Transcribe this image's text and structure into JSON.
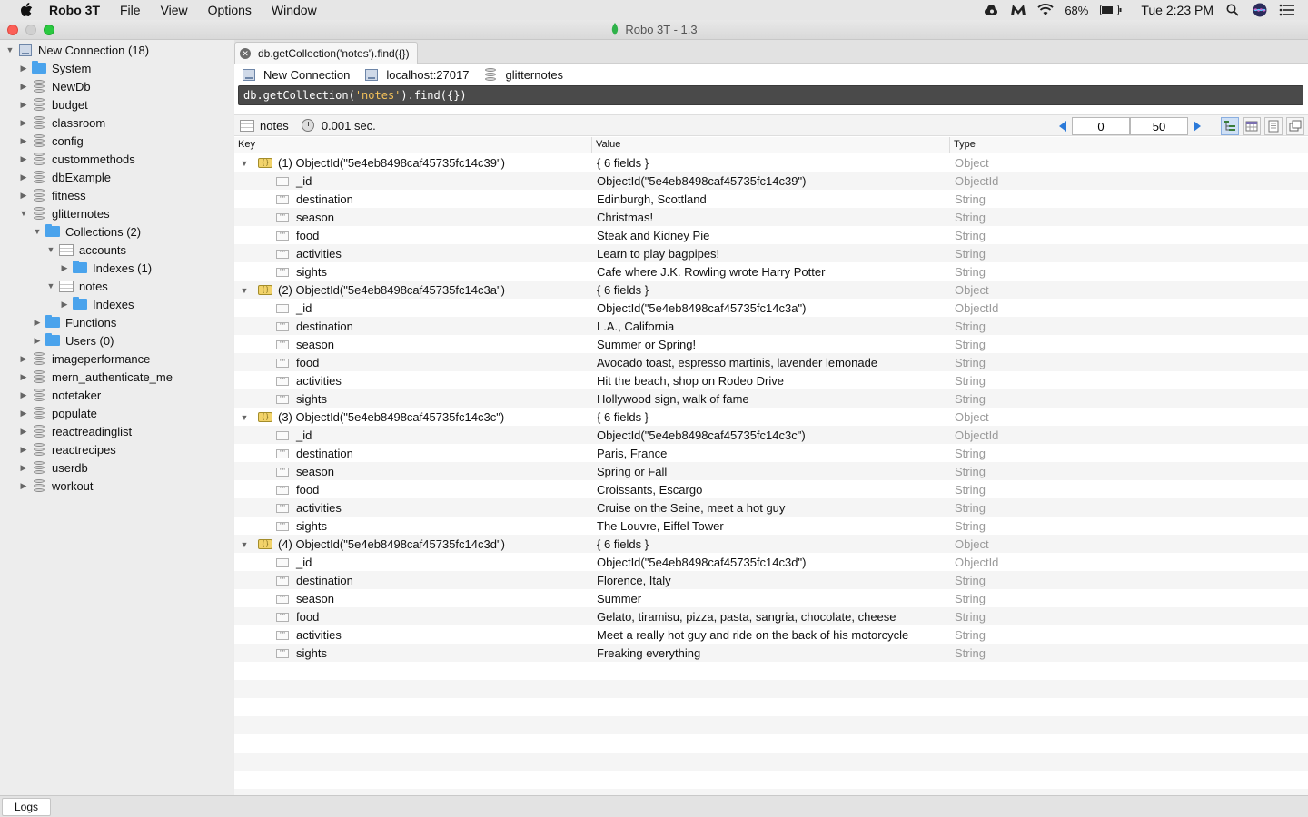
{
  "menubar": {
    "app_name": "Robo 3T",
    "items": [
      "File",
      "View",
      "Options",
      "Window"
    ],
    "battery": "68%",
    "clock": "Tue 2:23 PM"
  },
  "window": {
    "title": "Robo 3T - 1.3"
  },
  "sidebar": {
    "tree": [
      {
        "label": "New Connection (18)",
        "icon": "server-icon",
        "expanded": true,
        "depth": 0
      },
      {
        "label": "System",
        "icon": "folder-icon",
        "expanded": false,
        "depth": 1
      },
      {
        "label": "NewDb",
        "icon": "database-icon",
        "expanded": false,
        "depth": 1
      },
      {
        "label": "budget",
        "icon": "database-icon",
        "expanded": false,
        "depth": 1
      },
      {
        "label": "classroom",
        "icon": "database-icon",
        "expanded": false,
        "depth": 1
      },
      {
        "label": "config",
        "icon": "database-icon",
        "expanded": false,
        "depth": 1
      },
      {
        "label": "custommethods",
        "icon": "database-icon",
        "expanded": false,
        "depth": 1
      },
      {
        "label": "dbExample",
        "icon": "database-icon",
        "expanded": false,
        "depth": 1
      },
      {
        "label": "fitness",
        "icon": "database-icon",
        "expanded": false,
        "depth": 1
      },
      {
        "label": "glitternotes",
        "icon": "database-icon",
        "expanded": true,
        "depth": 1
      },
      {
        "label": "Collections (2)",
        "icon": "folder-icon",
        "expanded": true,
        "depth": 2
      },
      {
        "label": "accounts",
        "icon": "table-icon",
        "expanded": true,
        "depth": 3
      },
      {
        "label": "Indexes (1)",
        "icon": "folder-icon",
        "expanded": false,
        "depth": 4
      },
      {
        "label": "notes",
        "icon": "table-icon",
        "expanded": true,
        "depth": 3
      },
      {
        "label": "Indexes",
        "icon": "folder-icon",
        "expanded": false,
        "depth": 4
      },
      {
        "label": "Functions",
        "icon": "folder-icon",
        "expanded": false,
        "depth": 2
      },
      {
        "label": "Users (0)",
        "icon": "folder-icon",
        "expanded": false,
        "depth": 2
      },
      {
        "label": "imageperformance",
        "icon": "database-icon",
        "expanded": false,
        "depth": 1
      },
      {
        "label": "mern_authenticate_me",
        "icon": "database-icon",
        "expanded": false,
        "depth": 1
      },
      {
        "label": "notetaker",
        "icon": "database-icon",
        "expanded": false,
        "depth": 1
      },
      {
        "label": "populate",
        "icon": "database-icon",
        "expanded": false,
        "depth": 1
      },
      {
        "label": "reactreadinglist",
        "icon": "database-icon",
        "expanded": false,
        "depth": 1
      },
      {
        "label": "reactrecipes",
        "icon": "database-icon",
        "expanded": false,
        "depth": 1
      },
      {
        "label": "userdb",
        "icon": "database-icon",
        "expanded": false,
        "depth": 1
      },
      {
        "label": "workout",
        "icon": "database-icon",
        "expanded": false,
        "depth": 1
      }
    ]
  },
  "tab": {
    "label": "db.getCollection('notes').find({})"
  },
  "connection": {
    "name": "New Connection",
    "host": "localhost:27017",
    "database": "glitternotes"
  },
  "query": {
    "prefix": "db.getCollection(",
    "collection": "'notes'",
    "suffix": ").find({})"
  },
  "result": {
    "collection": "notes",
    "time": "0.001 sec.",
    "skip": "0",
    "limit": "50"
  },
  "grid": {
    "headers": {
      "key": "Key",
      "value": "Value",
      "type": "Type"
    },
    "documents": [
      {
        "key": "(1) ObjectId(\"5e4eb8498caf45735fc14c39\")",
        "value": "{ 6 fields }",
        "type": "Object",
        "fields": [
          {
            "key": "_id",
            "value": "ObjectId(\"5e4eb8498caf45735fc14c39\")",
            "type": "ObjectId"
          },
          {
            "key": "destination",
            "value": "Edinburgh, Scottland",
            "type": "String"
          },
          {
            "key": "season",
            "value": "Christmas!",
            "type": "String"
          },
          {
            "key": "food",
            "value": "Steak and Kidney Pie",
            "type": "String"
          },
          {
            "key": "activities",
            "value": "Learn to play bagpipes!",
            "type": "String"
          },
          {
            "key": "sights",
            "value": "Cafe where J.K. Rowling wrote Harry Potter",
            "type": "String"
          }
        ]
      },
      {
        "key": "(2) ObjectId(\"5e4eb8498caf45735fc14c3a\")",
        "value": "{ 6 fields }",
        "type": "Object",
        "fields": [
          {
            "key": "_id",
            "value": "ObjectId(\"5e4eb8498caf45735fc14c3a\")",
            "type": "ObjectId"
          },
          {
            "key": "destination",
            "value": "L.A., California",
            "type": "String"
          },
          {
            "key": "season",
            "value": "Summer or Spring!",
            "type": "String"
          },
          {
            "key": "food",
            "value": "Avocado toast, espresso martinis, lavender lemonade",
            "type": "String"
          },
          {
            "key": "activities",
            "value": "Hit the beach, shop on Rodeo Drive",
            "type": "String"
          },
          {
            "key": "sights",
            "value": "Hollywood sign, walk of fame",
            "type": "String"
          }
        ]
      },
      {
        "key": "(3) ObjectId(\"5e4eb8498caf45735fc14c3c\")",
        "value": "{ 6 fields }",
        "type": "Object",
        "fields": [
          {
            "key": "_id",
            "value": "ObjectId(\"5e4eb8498caf45735fc14c3c\")",
            "type": "ObjectId"
          },
          {
            "key": "destination",
            "value": "Paris, France",
            "type": "String"
          },
          {
            "key": "season",
            "value": "Spring or Fall",
            "type": "String"
          },
          {
            "key": "food",
            "value": "Croissants, Escargo",
            "type": "String"
          },
          {
            "key": "activities",
            "value": "Cruise on the Seine, meet a hot guy",
            "type": "String"
          },
          {
            "key": "sights",
            "value": "The Louvre, Eiffel Tower",
            "type": "String"
          }
        ]
      },
      {
        "key": "(4) ObjectId(\"5e4eb8498caf45735fc14c3d\")",
        "value": "{ 6 fields }",
        "type": "Object",
        "fields": [
          {
            "key": "_id",
            "value": "ObjectId(\"5e4eb8498caf45735fc14c3d\")",
            "type": "ObjectId"
          },
          {
            "key": "destination",
            "value": "Florence, Italy",
            "type": "String"
          },
          {
            "key": "season",
            "value": "Summer",
            "type": "String"
          },
          {
            "key": "food",
            "value": "Gelato, tiramisu, pizza, pasta, sangria, chocolate, cheese",
            "type": "String"
          },
          {
            "key": "activities",
            "value": "Meet a really hot guy and ride on the back of his motorcycle",
            "type": "String"
          },
          {
            "key": "sights",
            "value": "Freaking everything",
            "type": "String"
          }
        ]
      }
    ]
  },
  "logs": {
    "label": "Logs"
  }
}
